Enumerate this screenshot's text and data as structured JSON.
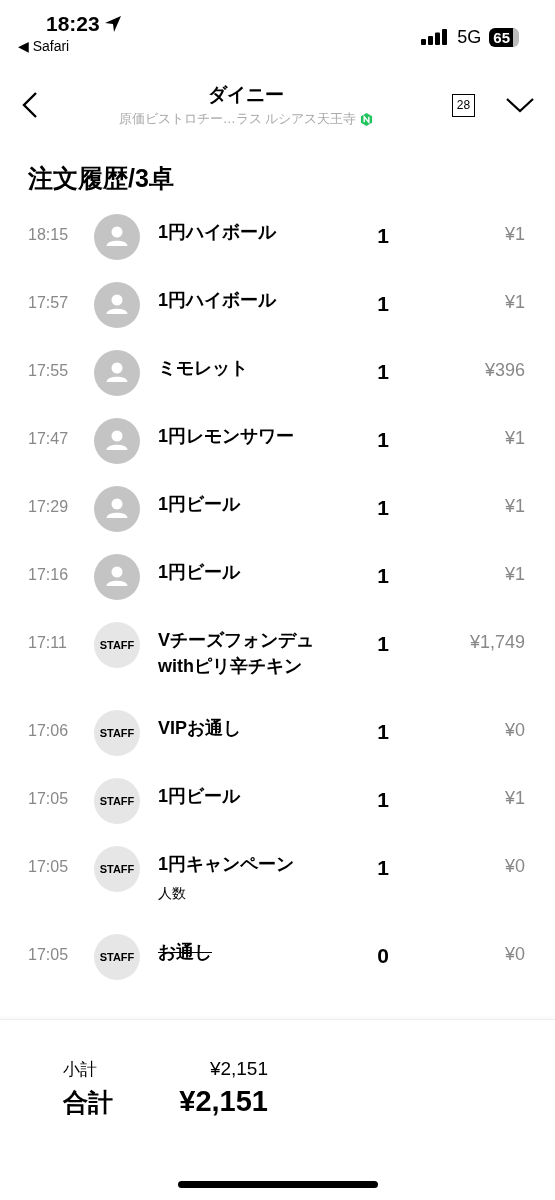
{
  "status_bar": {
    "time": "18:23",
    "back_app": "◀ Safari",
    "network": "5G",
    "battery": "65"
  },
  "nav": {
    "title": "ダイニー",
    "subtitle": "原価ビストロチー…ラス ルシアス天王寺",
    "calendar_day": "28"
  },
  "heading": "注文履歴/3卓",
  "orders": [
    {
      "time": "18:15",
      "kind": "guest",
      "name": "1円ハイボール",
      "qty": "1",
      "price": "¥1",
      "cancelled": false
    },
    {
      "time": "17:57",
      "kind": "guest",
      "name": "1円ハイボール",
      "qty": "1",
      "price": "¥1",
      "cancelled": false
    },
    {
      "time": "17:55",
      "kind": "guest",
      "name": "ミモレット",
      "qty": "1",
      "price": "¥396",
      "cancelled": false
    },
    {
      "time": "17:47",
      "kind": "guest",
      "name": "1円レモンサワー",
      "qty": "1",
      "price": "¥1",
      "cancelled": false
    },
    {
      "time": "17:29",
      "kind": "guest",
      "name": "1円ビール",
      "qty": "1",
      "price": "¥1",
      "cancelled": false
    },
    {
      "time": "17:16",
      "kind": "guest",
      "name": "1円ビール",
      "qty": "1",
      "price": "¥1",
      "cancelled": false
    },
    {
      "time": "17:11",
      "kind": "staff",
      "avatar_label": "STAFF",
      "name": "Vチーズフォンデュwithピリ辛チキン",
      "qty": "1",
      "price": "¥1,749",
      "cancelled": false
    },
    {
      "time": "17:06",
      "kind": "staff",
      "avatar_label": "STAFF",
      "name": "VIPお通し",
      "qty": "1",
      "price": "¥0",
      "cancelled": false
    },
    {
      "time": "17:05",
      "kind": "staff",
      "avatar_label": "STAFF",
      "name": "1円ビール",
      "qty": "1",
      "price": "¥1",
      "cancelled": false
    },
    {
      "time": "17:05",
      "kind": "staff",
      "avatar_label": "STAFF",
      "name": "1円キャンペーン",
      "note": "人数",
      "qty": "1",
      "price": "¥0",
      "cancelled": false
    },
    {
      "time": "17:05",
      "kind": "staff",
      "avatar_label": "STAFF",
      "name": "お通し",
      "qty": "0",
      "price": "¥0",
      "cancelled": true
    }
  ],
  "summary": {
    "subtotal_label": "小計",
    "subtotal": "¥2,151",
    "total_label": "合計",
    "total": "¥2,151"
  }
}
